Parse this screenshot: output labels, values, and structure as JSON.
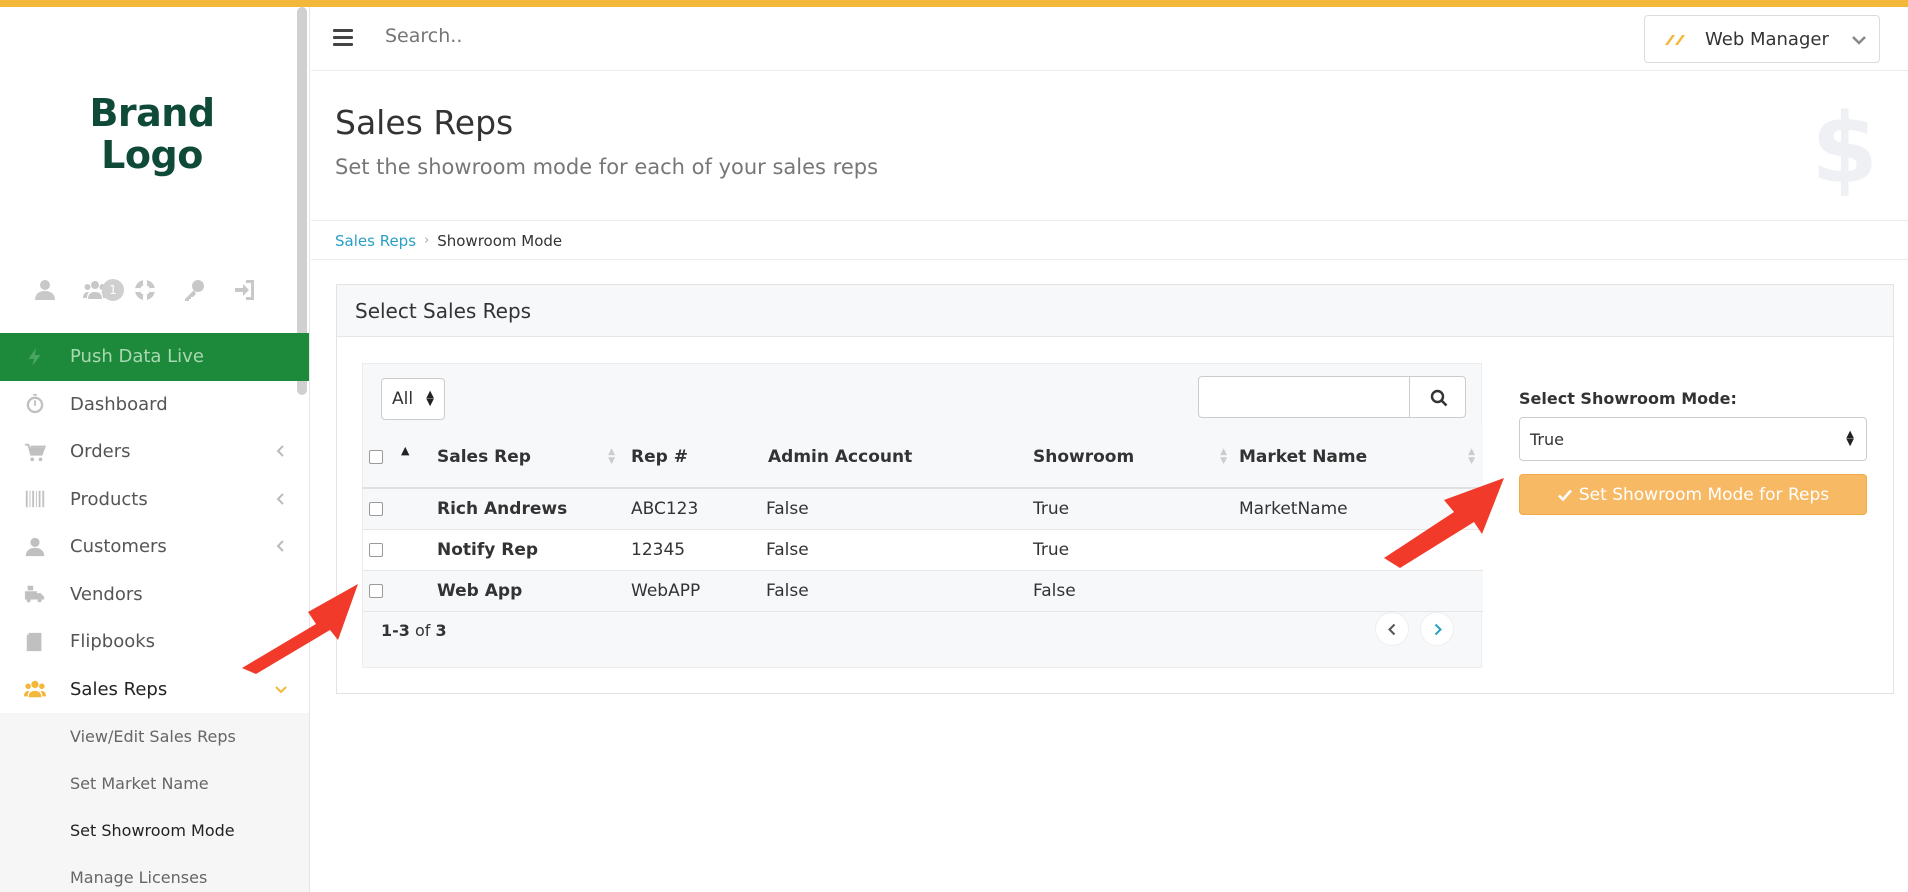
{
  "brand": {
    "line1": "Brand",
    "line2": "Logo"
  },
  "quick_icons": [
    {
      "icon": "user-icon"
    },
    {
      "icon": "group-icon",
      "badge": "1"
    },
    {
      "icon": "lifebuoy-icon"
    },
    {
      "icon": "key-icon"
    },
    {
      "icon": "sign-in-icon"
    }
  ],
  "sidebar": {
    "items": [
      {
        "label": "Push Data Live",
        "icon": "bolt-icon"
      },
      {
        "label": "Dashboard",
        "icon": "stopwatch-icon"
      },
      {
        "label": "Orders",
        "icon": "cart-icon"
      },
      {
        "label": "Products",
        "icon": "barcode-icon"
      },
      {
        "label": "Customers",
        "icon": "user-icon"
      },
      {
        "label": "Vendors",
        "icon": "truck-icon"
      },
      {
        "label": "Flipbooks",
        "icon": "book-icon"
      },
      {
        "label": "Sales Reps",
        "icon": "group-icon"
      }
    ],
    "sub_items": [
      {
        "label": "View/Edit Sales Reps"
      },
      {
        "label": "Set Market Name"
      },
      {
        "label": "Set Showroom Mode"
      },
      {
        "label": "Manage Licenses"
      }
    ]
  },
  "header": {
    "search_placeholder": "Search..",
    "user_name": "Web Manager"
  },
  "page": {
    "title": "Sales Reps",
    "subtitle": "Set the showroom mode for each of your sales reps",
    "icon": "dollar-icon",
    "icon_glyph": "$"
  },
  "breadcrumb": {
    "link": "Sales Reps",
    "current": "Showroom Mode"
  },
  "panel": {
    "title": "Select Sales Reps",
    "filter": "All",
    "columns": [
      "Sales Rep",
      "Rep #",
      "Admin Account",
      "Showroom",
      "Market Name"
    ],
    "rows": [
      {
        "name": "Rich Andrews",
        "rep": "ABC123",
        "admin": "False",
        "showroom": "True",
        "market": "MarketName"
      },
      {
        "name": "Notify Rep",
        "rep": "12345",
        "admin": "False",
        "showroom": "True",
        "market": ""
      },
      {
        "name": "Web App",
        "rep": "WebAPP",
        "admin": "False",
        "showroom": "False",
        "market": ""
      }
    ],
    "pager": {
      "range": "1-3",
      "of": "of",
      "total": "3"
    }
  },
  "showroom": {
    "label": "Select Showroom Mode:",
    "value": "True",
    "button": "Set Showroom Mode for Reps"
  },
  "colors": {
    "accent": "#f3b73a",
    "brand": "#0f4a39",
    "push": "#1c8a3a",
    "button": "#f8b964",
    "link": "#2a9fc6",
    "arrow": "#f23a2a"
  }
}
